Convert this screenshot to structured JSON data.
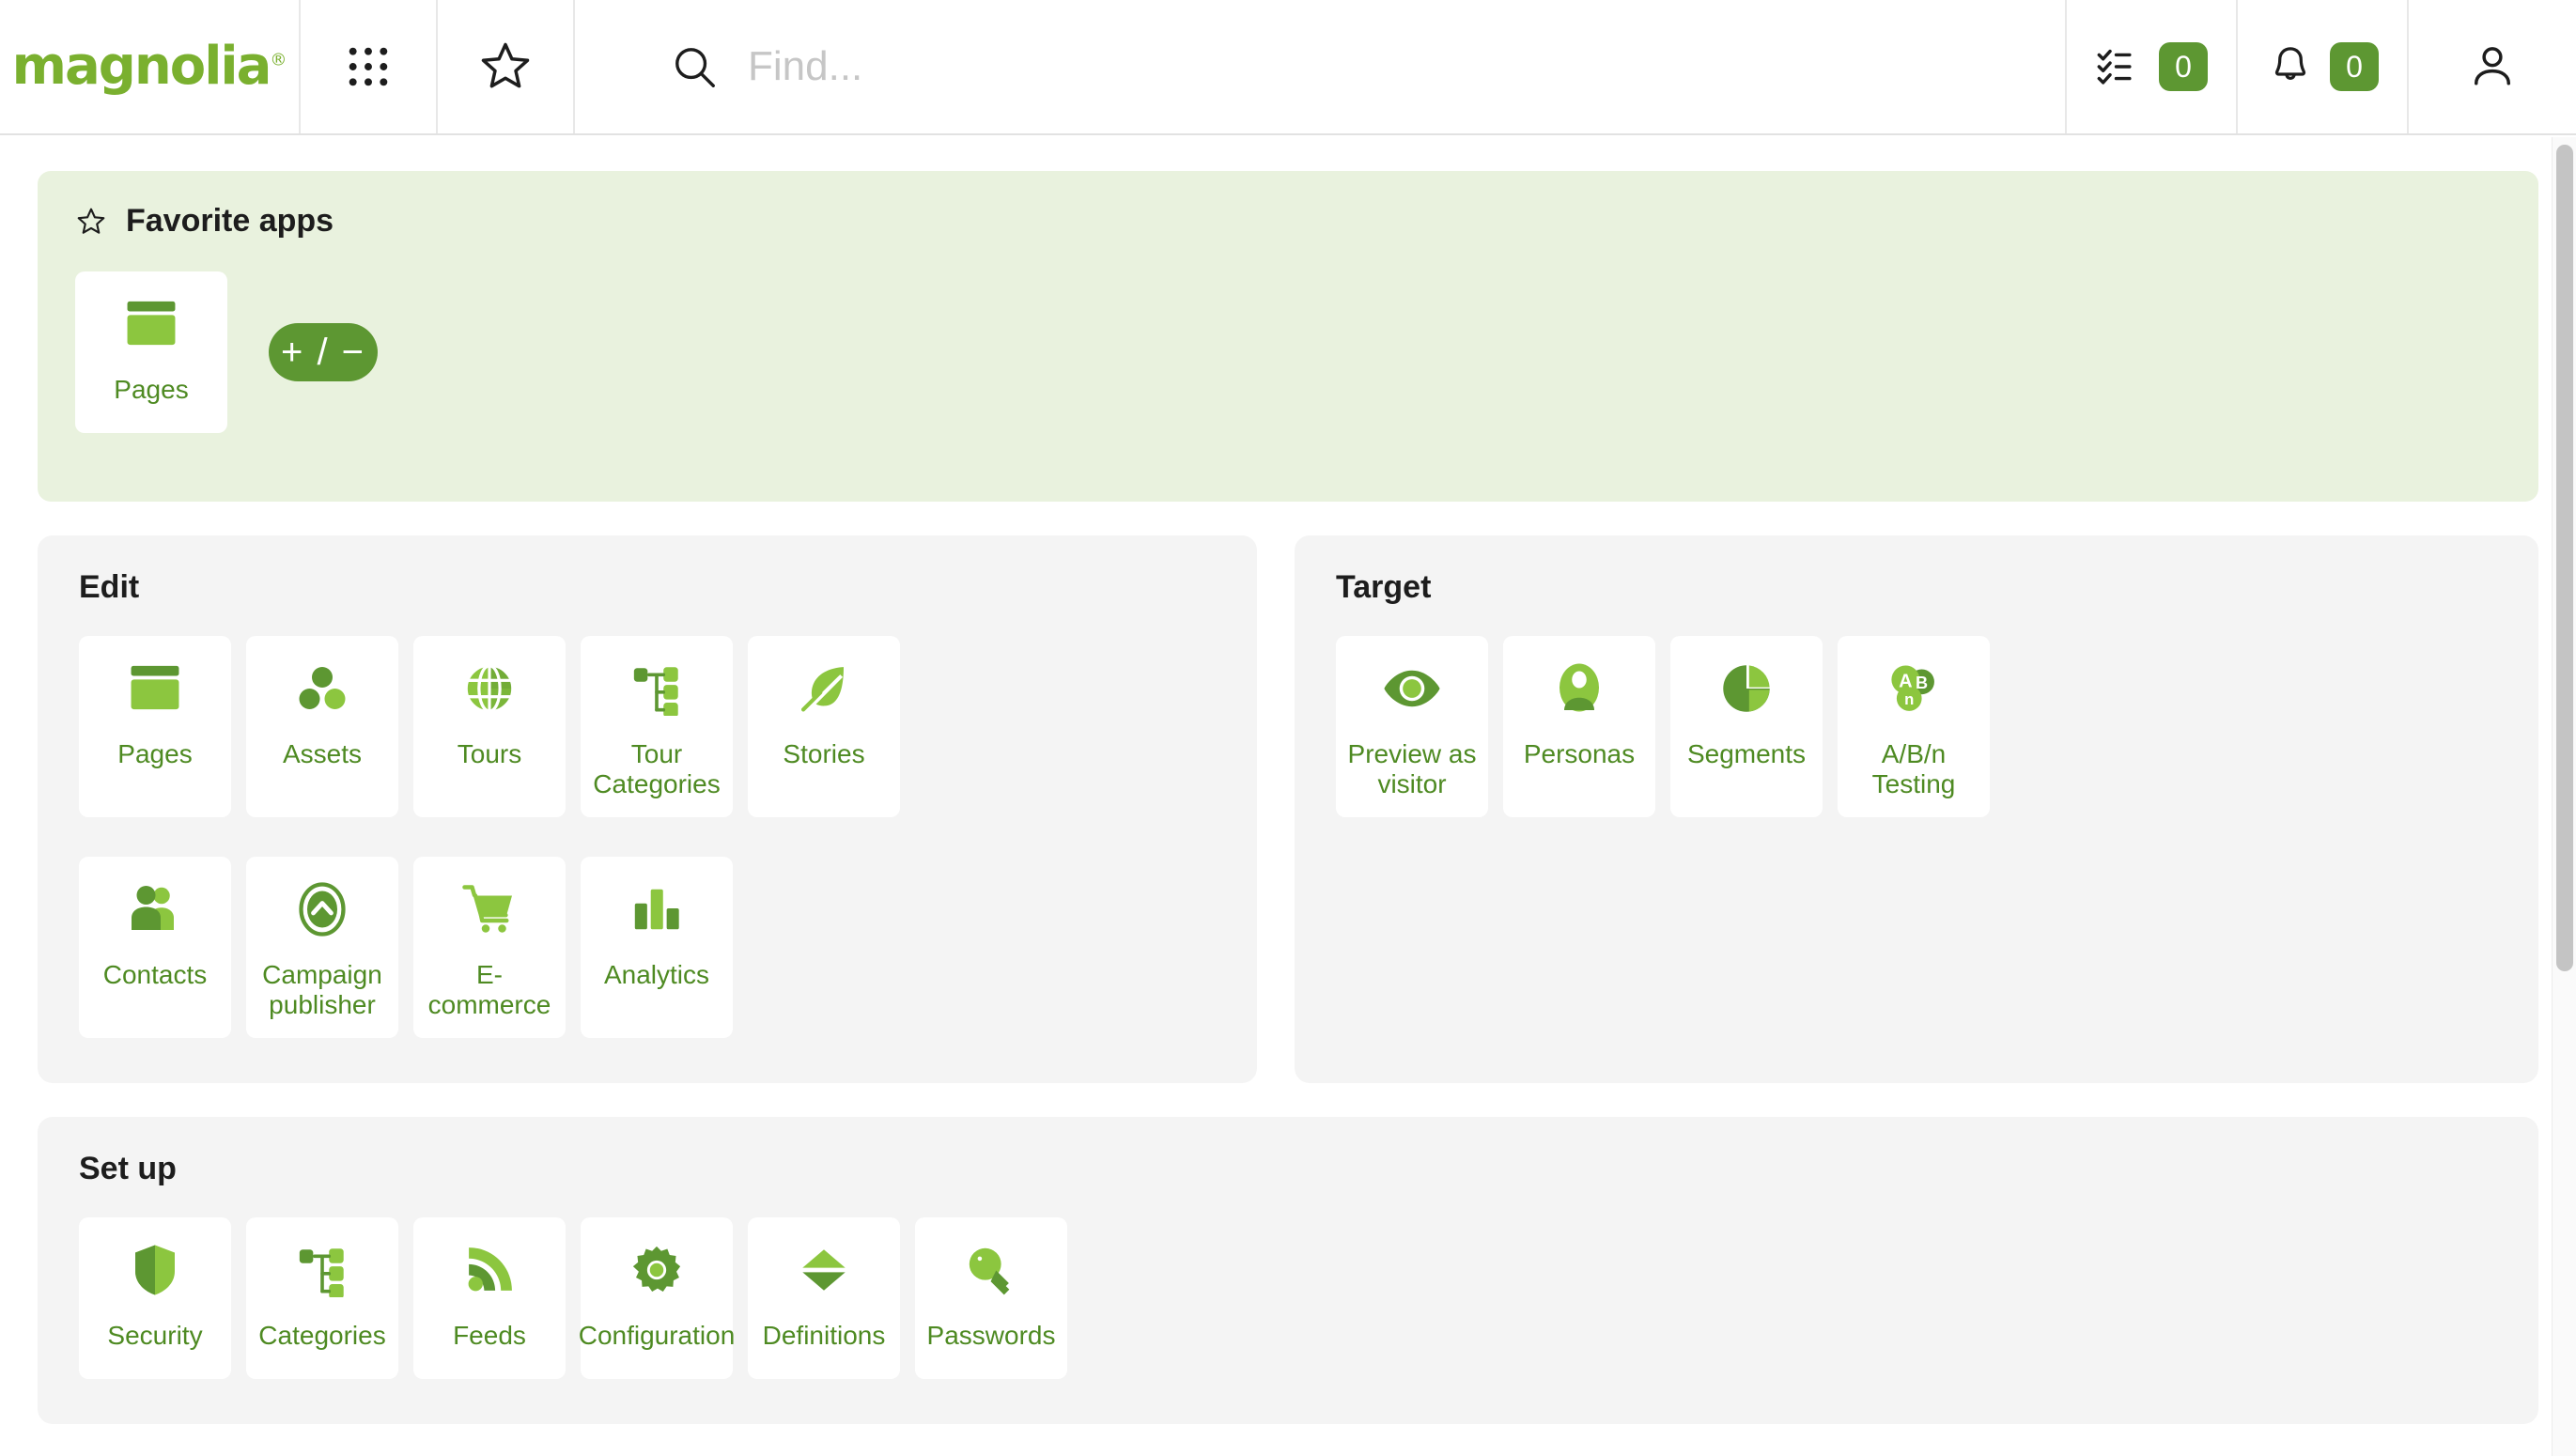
{
  "header": {
    "logo_text": "magnolia",
    "logo_mark": "®",
    "apps_icon": "grid-apps-icon",
    "favorites_icon": "star-icon",
    "search": {
      "icon": "search-icon",
      "placeholder": "Find...",
      "value": ""
    },
    "tasks": {
      "icon": "tasks-checklist-icon",
      "count": "0"
    },
    "notifications": {
      "icon": "bell-icon",
      "count": "0"
    },
    "user": {
      "icon": "user-avatar-icon"
    }
  },
  "favorites": {
    "title": "Favorite apps",
    "title_icon": "star-icon",
    "edit_button_label": "+ / −",
    "apps": [
      {
        "label": "Pages",
        "icon": "pages-icon"
      }
    ]
  },
  "sections": [
    {
      "title": "Edit",
      "apps": [
        {
          "label": "Pages",
          "icon": "pages-icon"
        },
        {
          "label": "Assets",
          "icon": "assets-icon"
        },
        {
          "label": "Tours",
          "icon": "globe-icon"
        },
        {
          "label": "Tour Categories",
          "icon": "tree-categories-icon"
        },
        {
          "label": "Stories",
          "icon": "quill-leaf-icon"
        },
        {
          "label": "Contacts",
          "icon": "contacts-people-icon"
        },
        {
          "label": "Campaign publisher",
          "icon": "campaign-publish-icon"
        },
        {
          "label": "E-commerce",
          "icon": "shopping-cart-icon"
        },
        {
          "label": "Analytics",
          "icon": "bar-chart-icon"
        }
      ]
    },
    {
      "title": "Target",
      "apps": [
        {
          "label": "Preview as visitor",
          "icon": "eye-icon"
        },
        {
          "label": "Personas",
          "icon": "persona-icon"
        },
        {
          "label": "Segments",
          "icon": "pie-chart-icon"
        },
        {
          "label": "A/B/n Testing",
          "icon": "abn-testing-icon"
        }
      ]
    },
    {
      "title": "Set up",
      "apps": [
        {
          "label": "Security",
          "icon": "shield-icon"
        },
        {
          "label": "Categories",
          "icon": "tree-categories-icon"
        },
        {
          "label": "Feeds",
          "icon": "rss-feed-icon"
        },
        {
          "label": "Configuration",
          "icon": "gear-icon"
        },
        {
          "label": "Definitions",
          "icon": "diamond-arrows-icon"
        },
        {
          "label": "Passwords",
          "icon": "key-icon"
        }
      ]
    }
  ],
  "colors": {
    "green_dark": "#5d9732",
    "green_light": "#8cc63f",
    "brand_logo": "#7ab02f",
    "panel_bg": "#f4f4f4",
    "favorites_bg": "#e9f2de",
    "label_text": "#4e8a22"
  }
}
